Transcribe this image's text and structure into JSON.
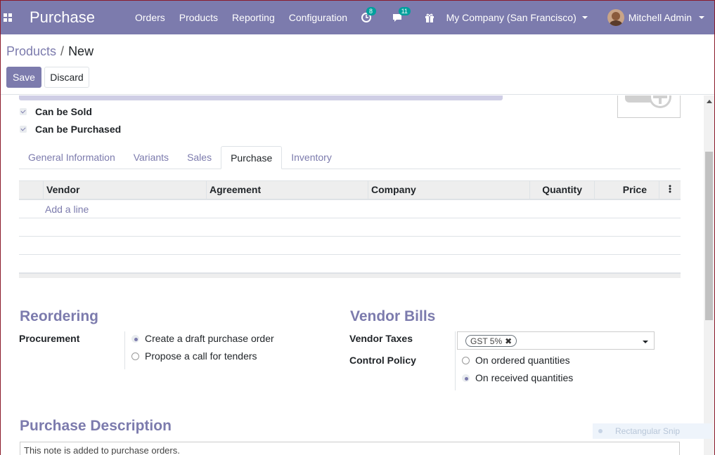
{
  "navbar": {
    "brand": "Purchase",
    "menu": [
      "Orders",
      "Products",
      "Reporting",
      "Configuration"
    ],
    "activity_badge": "8",
    "messages_badge": "11",
    "company": "My Company (San Francisco)",
    "user": "Mitchell Admin"
  },
  "control_panel": {
    "breadcrumb_parent": "Products",
    "breadcrumb_separator": "/",
    "breadcrumb_current": "New",
    "save_label": "Save",
    "discard_label": "Discard"
  },
  "form": {
    "checkboxes": [
      {
        "label": "Can be Sold",
        "checked": true
      },
      {
        "label": "Can be Purchased",
        "checked": true
      }
    ],
    "tabs": [
      "General Information",
      "Variants",
      "Sales",
      "Purchase",
      "Inventory"
    ],
    "active_tab": "Purchase",
    "vendor_table": {
      "columns": [
        "Vendor",
        "Agreement",
        "Company",
        "Quantity",
        "Price"
      ],
      "add_line": "Add a line"
    },
    "reordering": {
      "title": "Reordering",
      "procurement_label": "Procurement",
      "procurement_options": [
        {
          "label": "Create a draft purchase order",
          "checked": true
        },
        {
          "label": "Propose a call for tenders",
          "checked": false
        }
      ]
    },
    "vendor_bills": {
      "title": "Vendor Bills",
      "taxes_label": "Vendor Taxes",
      "tax_tag": "GST 5%",
      "control_policy_label": "Control Policy",
      "control_policy_options": [
        {
          "label": "On ordered quantities",
          "checked": false
        },
        {
          "label": "On received quantities",
          "checked": true
        }
      ]
    },
    "purchase_description": {
      "title": "Purchase Description",
      "placeholder": "This note is added to purchase orders."
    }
  },
  "overlay": {
    "snip_label": "Rectangular Snip"
  },
  "colors": {
    "brand": "#7c7bad",
    "accent_badge": "#00a09d"
  }
}
